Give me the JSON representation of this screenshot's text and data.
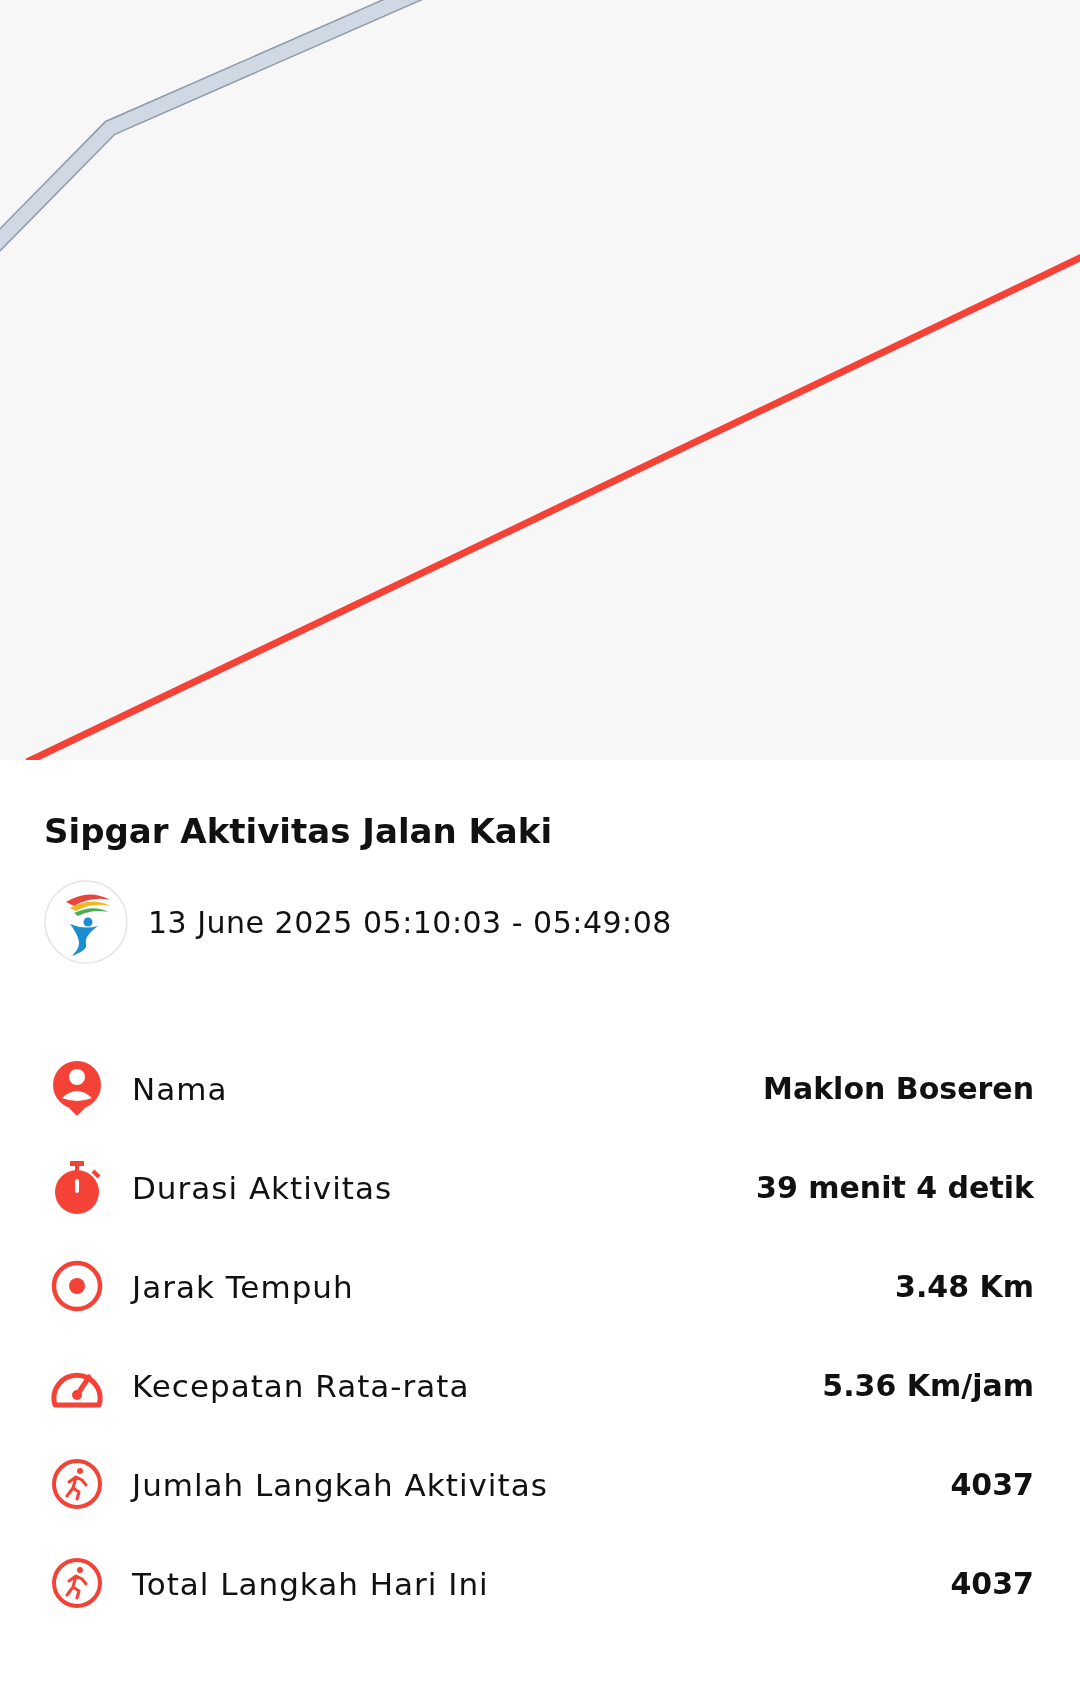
{
  "activity": {
    "title": "Sipgar Aktivitas Jalan Kaki",
    "time_range": "13 June 2025 05:10:03 - 05:49:08"
  },
  "stats": [
    {
      "kind": "person",
      "label": "Nama",
      "value": "Maklon Boseren"
    },
    {
      "kind": "stopwatch",
      "label": "Durasi Aktivitas",
      "value": "39 menit 4 detik"
    },
    {
      "kind": "target",
      "label": "Jarak Tempuh",
      "value": "3.48 Km"
    },
    {
      "kind": "speedometer",
      "label": "Kecepatan Rata-rata",
      "value": "5.36 Km/jam"
    },
    {
      "kind": "runner",
      "label": "Jumlah Langkah Aktivitas",
      "value": "4037"
    },
    {
      "kind": "runner",
      "label": "Total Langkah Hari Ini",
      "value": "4037"
    }
  ]
}
